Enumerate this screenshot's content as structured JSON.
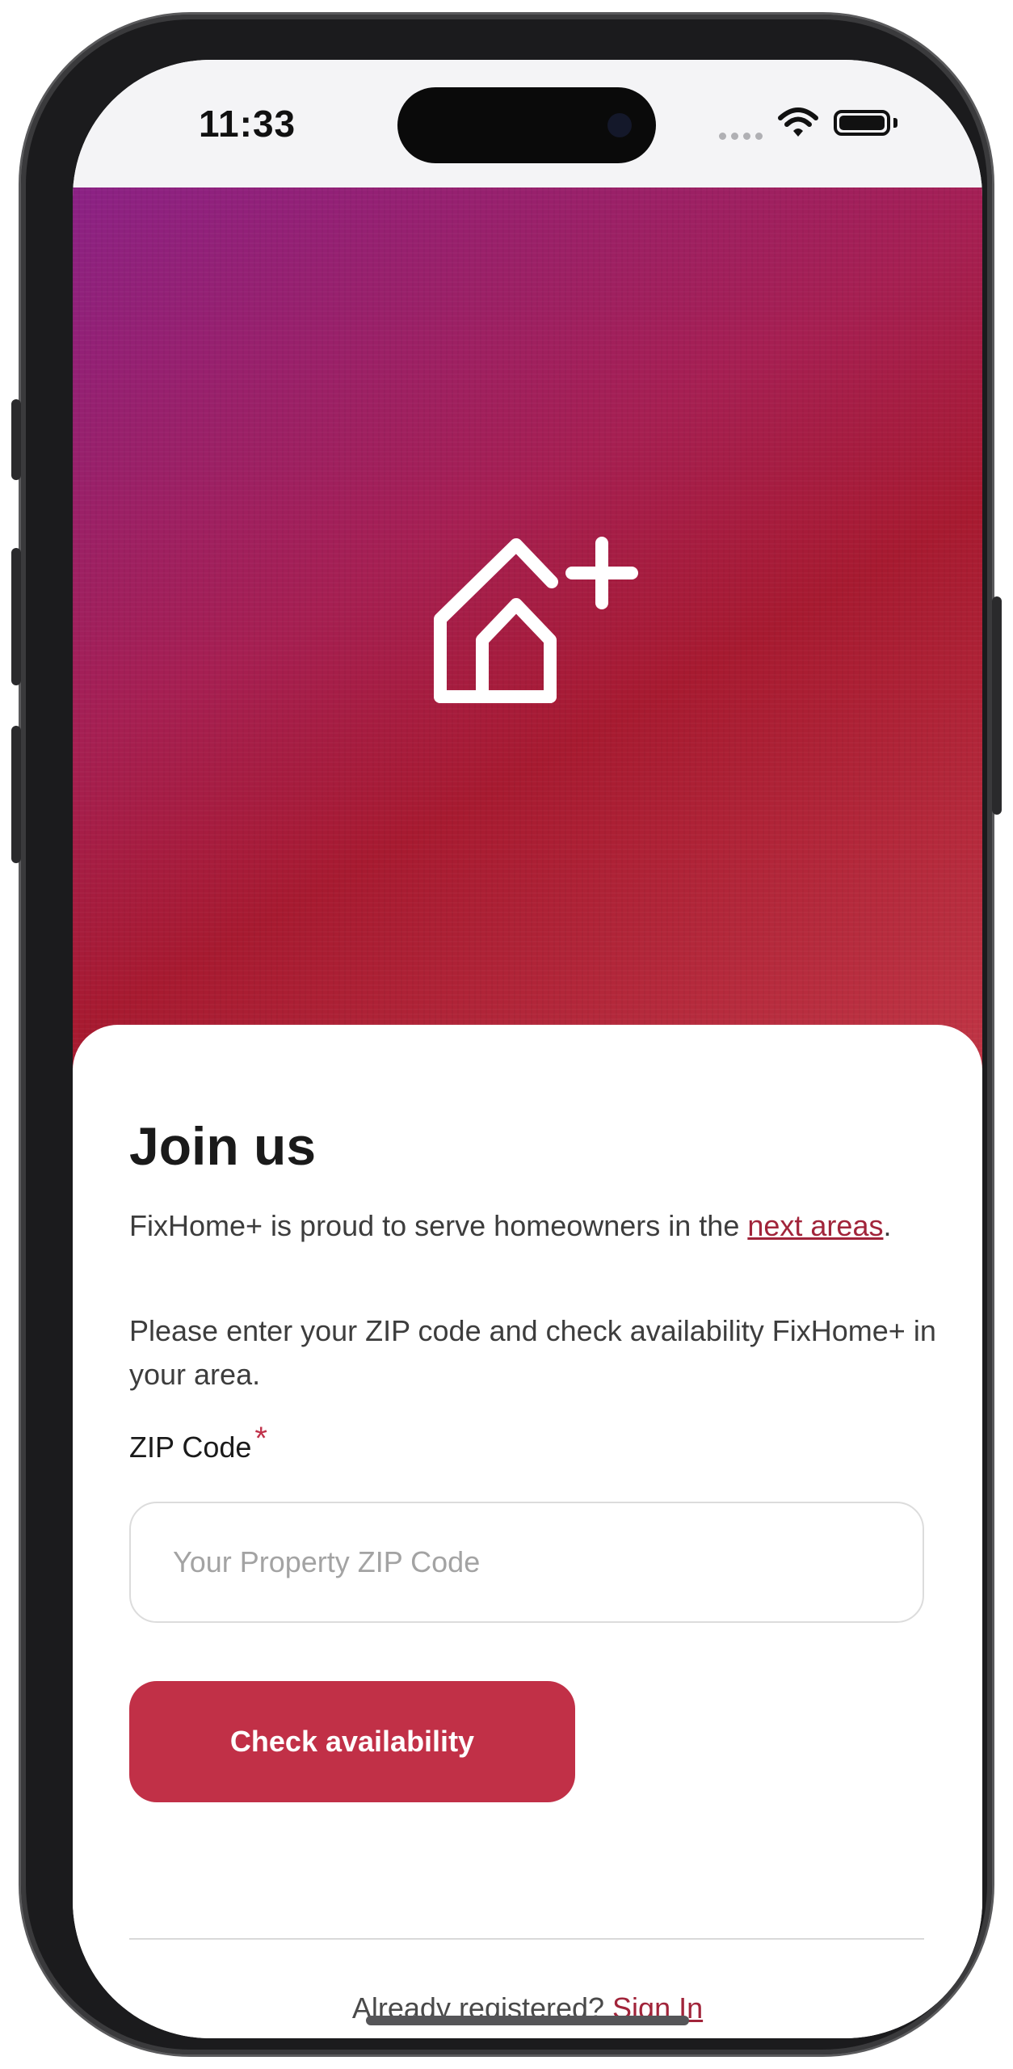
{
  "status_bar": {
    "time": "11:33"
  },
  "brand": {
    "logo_icon": "house-plus-icon",
    "accent_color": "#c13047",
    "link_color": "#a1243a"
  },
  "signup": {
    "title": "Join us",
    "intro_text": "FixHome+ is proud to serve homeowners in the ",
    "intro_link": "next areas",
    "intro_end": ".",
    "instructions": "Please enter your ZIP code and check availability FixHome+ in your area.",
    "zip_label": "ZIP Code",
    "required_mark": "*",
    "zip_value": "",
    "zip_placeholder": "Your Property ZIP Code",
    "check_button": "Check availability",
    "registered_text": "Already registered? ",
    "signin_link": "Sign In"
  }
}
